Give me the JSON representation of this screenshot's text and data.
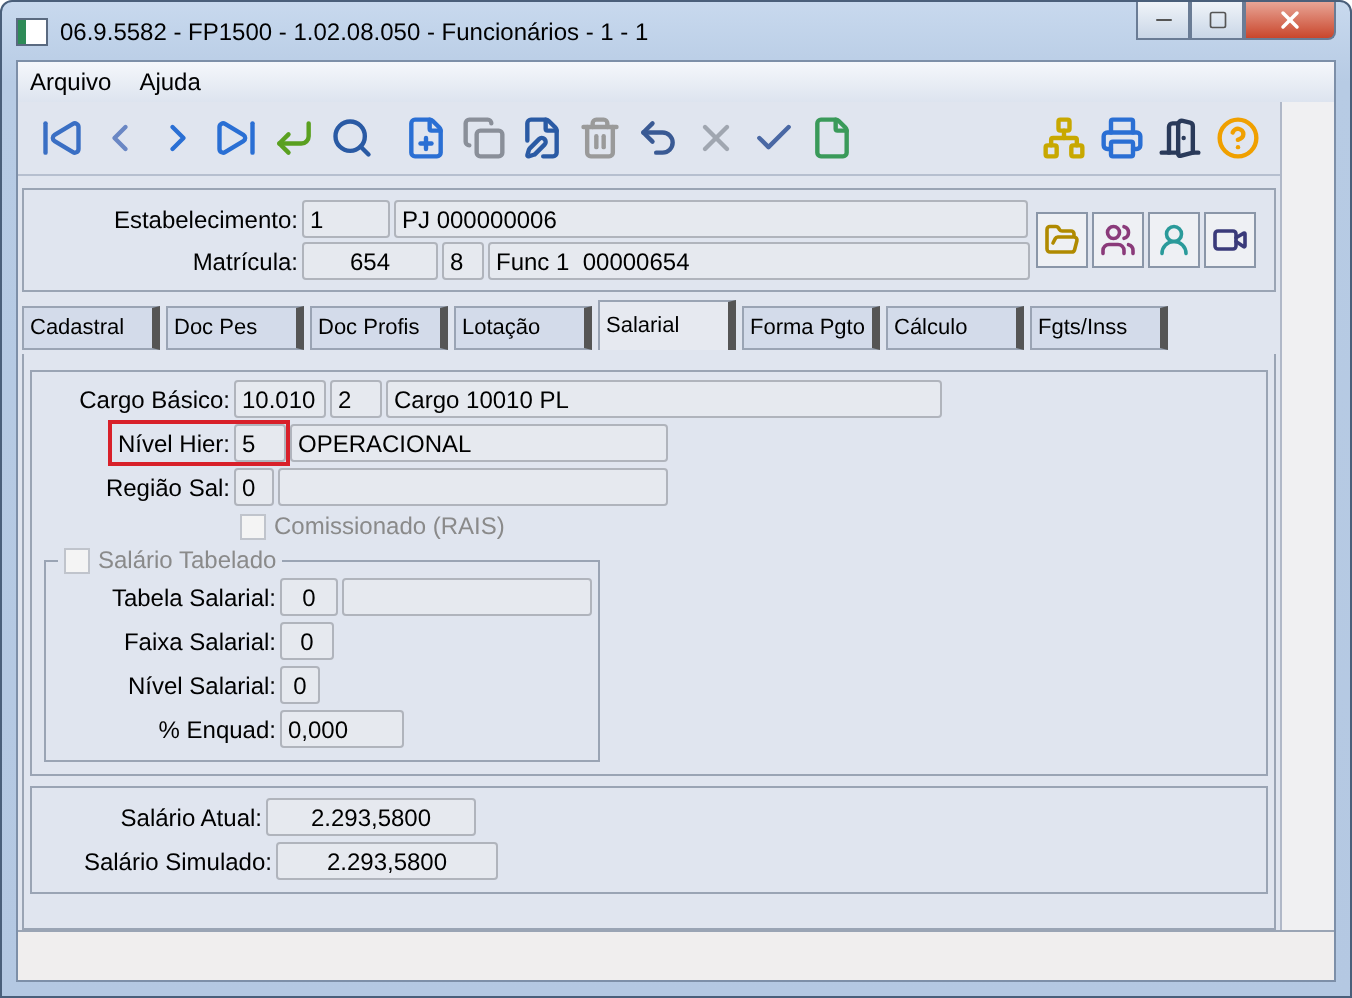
{
  "window": {
    "title": "06.9.5582 - FP1500 - 1.02.08.050 - Funcionários - 1 - 1"
  },
  "menu": [
    {
      "label": "Arquivo"
    },
    {
      "label": "Ajuda"
    }
  ],
  "header": {
    "rows": [
      {
        "label": "Estabelecimento:",
        "values": [
          "1",
          "PJ 000000006"
        ]
      },
      {
        "label": "Matrícula:",
        "values": [
          "654",
          "8",
          "Func 1  00000654"
        ]
      }
    ]
  },
  "tabs": [
    {
      "label": "Cadastral",
      "selected": false
    },
    {
      "label": "Doc Pes",
      "selected": false
    },
    {
      "label": "Doc Profis",
      "selected": false
    },
    {
      "label": "Lotação",
      "selected": false
    },
    {
      "label": "Salarial",
      "selected": true
    },
    {
      "label": "Forma Pgto",
      "selected": false
    },
    {
      "label": "Cálculo",
      "selected": false
    },
    {
      "label": "Fgts/Inss",
      "selected": false
    }
  ],
  "salarial": {
    "fields": [
      {
        "label": "Cargo Básico:",
        "values": [
          "10.010",
          "2",
          "Cargo 10010 PL"
        ],
        "highlighted": false
      },
      {
        "label": "Nível Hier:",
        "values": [
          "5",
          "OPERACIONAL"
        ],
        "highlighted": true
      },
      {
        "label": "Região Sal:",
        "values": [
          "0"
        ],
        "highlighted": false
      }
    ],
    "comissionado": {
      "label": "Comissionado (RAIS)",
      "checked": false,
      "disabled": true
    },
    "salario_tabelado": {
      "label": "Salário Tabelado",
      "checked": false,
      "disabled": true,
      "fields": [
        {
          "label": "Tabela Salarial:",
          "values": [
            "0"
          ]
        },
        {
          "label": "Faixa Salarial:",
          "values": [
            "0"
          ]
        },
        {
          "label": "Nível Salarial:",
          "values": [
            "0"
          ]
        },
        {
          "label": "% Enquad:",
          "values": [
            "0,000"
          ]
        }
      ]
    }
  },
  "totals": [
    {
      "label": "Salário Atual:",
      "value": "2.293,5800"
    },
    {
      "label": "Salário Simulado:",
      "value": "2.293,5800"
    }
  ]
}
